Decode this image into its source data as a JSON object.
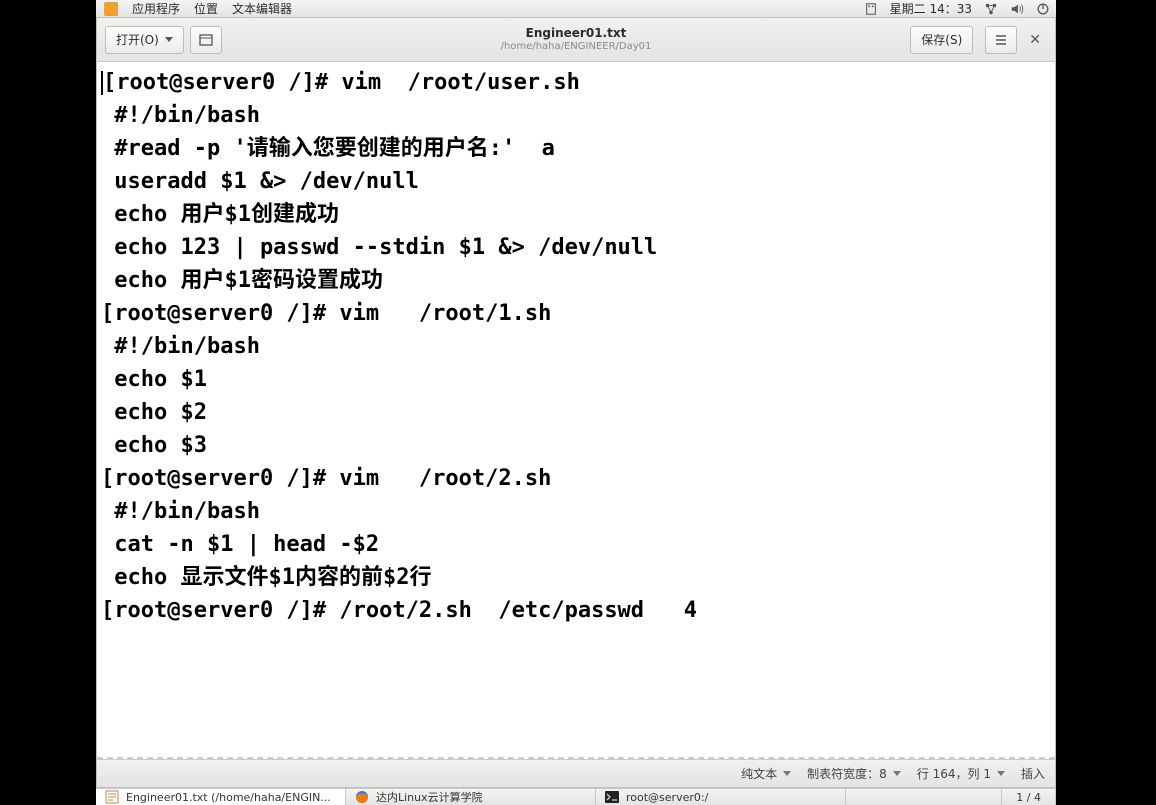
{
  "panel": {
    "apps_label": "应用程序",
    "places_label": "位置",
    "app_name": "文本编辑器",
    "clock": "星期二 14：33"
  },
  "toolbar": {
    "open_label": "打开(O)",
    "save_label": "保存(S)",
    "title": "Engineer01.txt",
    "subtitle": "/home/haha/ENGINEER/Day01"
  },
  "document": {
    "lines": [
      "[root@server0 /]# vim  /root/user.sh",
      " #!/bin/bash",
      " #read -p '请输入您要创建的用户名:'  a",
      " useradd $1 &> /dev/null",
      " echo 用户$1创建成功",
      " echo 123 | passwd --stdin $1 &> /dev/null",
      " echo 用户$1密码设置成功",
      "[root@server0 /]# vim   /root/1.sh",
      " #!/bin/bash",
      " echo $1",
      " echo $2",
      " echo $3",
      "[root@server0 /]# vim   /root/2.sh",
      " #!/bin/bash",
      " cat -n $1 | head -$2",
      " echo 显示文件$1内容的前$2行",
      "[root@server0 /]# /root/2.sh  /etc/passwd   4"
    ]
  },
  "status": {
    "syntax": "纯文本",
    "tabwidth": "制表符宽度：8",
    "position": "行 164，列 1",
    "mode": "插入"
  },
  "taskbar": {
    "items": [
      {
        "label": "Engineer01.txt (/home/haha/ENGIN...",
        "icon": "editor"
      },
      {
        "label": "达内Linux云计算学院",
        "icon": "firefox"
      },
      {
        "label": "root@server0:/",
        "icon": "terminal"
      }
    ],
    "pager": "1 / 4"
  }
}
